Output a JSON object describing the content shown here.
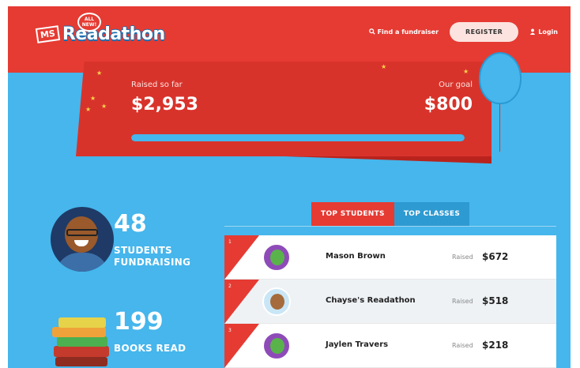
{
  "header": {
    "logo_ms": "MS",
    "logo_brand": "Readathon",
    "logo_badge": "ALL NEW!",
    "find_label": "Find a fundraiser",
    "register_label": "REGISTER",
    "login_label": "Login"
  },
  "banner": {
    "raised_label": "Raised so far",
    "raised_value": "$2,953",
    "goal_label": "Our goal",
    "goal_value": "$800",
    "progress_fraction": 1.0
  },
  "stats": {
    "students_count": "48",
    "students_label": "STUDENTS FUNDRAISING",
    "books_count": "199",
    "books_label": "BOOKS READ"
  },
  "leaderboard": {
    "tabs": [
      "TOP STUDENTS",
      "TOP CLASSES"
    ],
    "active_tab": "TOP STUDENTS",
    "raised_prefix": "Raised",
    "rows": [
      {
        "rank": "1",
        "name": "Mason Brown",
        "amount": "$672",
        "avatar": "monster-avatar"
      },
      {
        "rank": "2",
        "name": "Chayse's Readathon",
        "amount": "$518",
        "avatar": "photo-avatar"
      },
      {
        "rank": "3",
        "name": "Jaylen Travers",
        "amount": "$218",
        "avatar": "monster-avatar"
      }
    ]
  },
  "colors": {
    "header_red": "#e53b33",
    "sky_blue": "#46b6ec",
    "banner_red": "#d8332b"
  }
}
